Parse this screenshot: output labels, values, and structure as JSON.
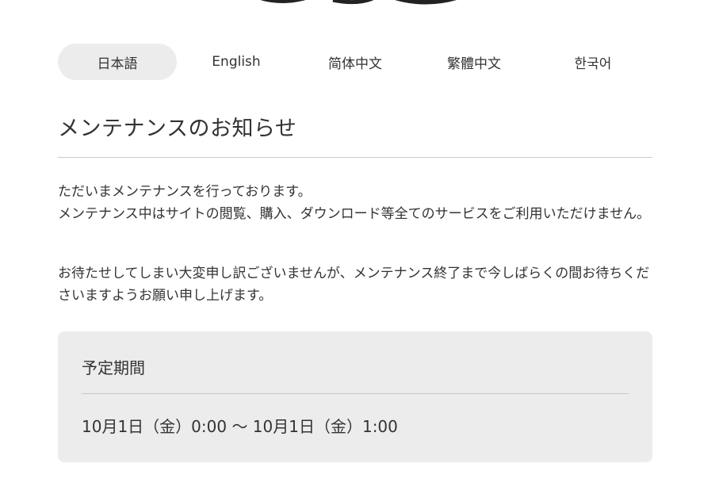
{
  "languages": [
    {
      "label": "日本語",
      "active": true
    },
    {
      "label": "English",
      "active": false
    },
    {
      "label": "简体中文",
      "active": false
    },
    {
      "label": "繁體中文",
      "active": false
    },
    {
      "label": "한국어",
      "active": false
    }
  ],
  "notice": {
    "title": "メンテナンスのお知らせ",
    "paragraph1": "ただいまメンテナンスを行っております。\nメンテナンス中はサイトの閲覧、購入、ダウンロード等全てのサービスをご利用いただけません。",
    "paragraph2": "お待たせしてしまい大変申し訳ございませんが、メンテナンス終了まで今しばらくの間お待ちくださいますようお願い申し上げます。"
  },
  "schedule": {
    "heading": "予定期間",
    "period": "10月1日（金）0:00 ～ 10月1日（金）1:00"
  },
  "colors": {
    "active_tab_bg": "#ececec",
    "schedule_bg": "#ececec",
    "text": "#333333"
  }
}
